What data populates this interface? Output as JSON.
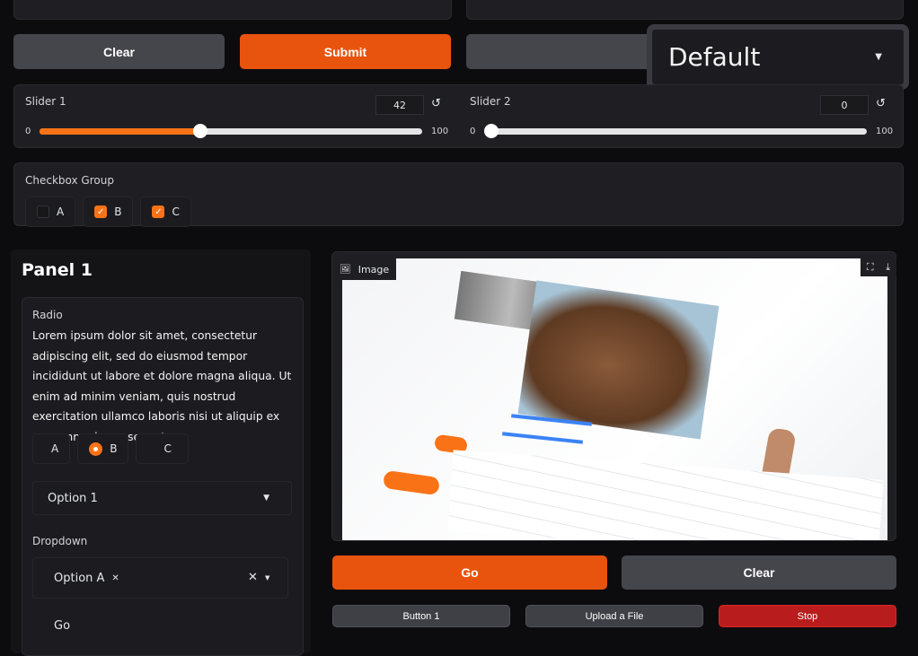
{
  "top_buttons": {
    "clear": "Clear",
    "submit": "Submit"
  },
  "theme_dropdown": {
    "value": "Default"
  },
  "slider1": {
    "label": "Slider 1",
    "value": 42,
    "min": "0",
    "max": "100",
    "value_text": "42"
  },
  "slider2": {
    "label": "Slider 2",
    "value": 0,
    "min": "0",
    "max": "100",
    "value_text": "0"
  },
  "checkbox_group": {
    "label": "Checkbox Group",
    "options": [
      {
        "label": "A",
        "checked": false
      },
      {
        "label": "B",
        "checked": true
      },
      {
        "label": "C",
        "checked": true
      }
    ]
  },
  "panel": {
    "title": "Panel 1",
    "radio_label": "Radio",
    "radio_info": "Lorem ipsum dolor sit amet, consectetur adipiscing elit, sed do eiusmod tempor incididunt ut labore et dolore magna aliqua. Ut enim ad minim veniam, quis nostrud exercitation ullamco laboris nisi ut aliquip ex ea commodo consequat.",
    "radio_options": [
      "A",
      "B",
      "C"
    ],
    "radio_selected": "B",
    "select_value": "Option 1",
    "dropdown_label": "Dropdown",
    "dropdown_chip": "Option A",
    "go": "Go"
  },
  "image": {
    "label": "Image"
  },
  "actions": {
    "go": "Go",
    "clear": "Clear",
    "button1": "Button 1",
    "upload": "Upload a File",
    "stop": "Stop"
  },
  "colors": {
    "primary": "#e8540e",
    "stop": "#b91c1c",
    "accent": "#f97316"
  }
}
